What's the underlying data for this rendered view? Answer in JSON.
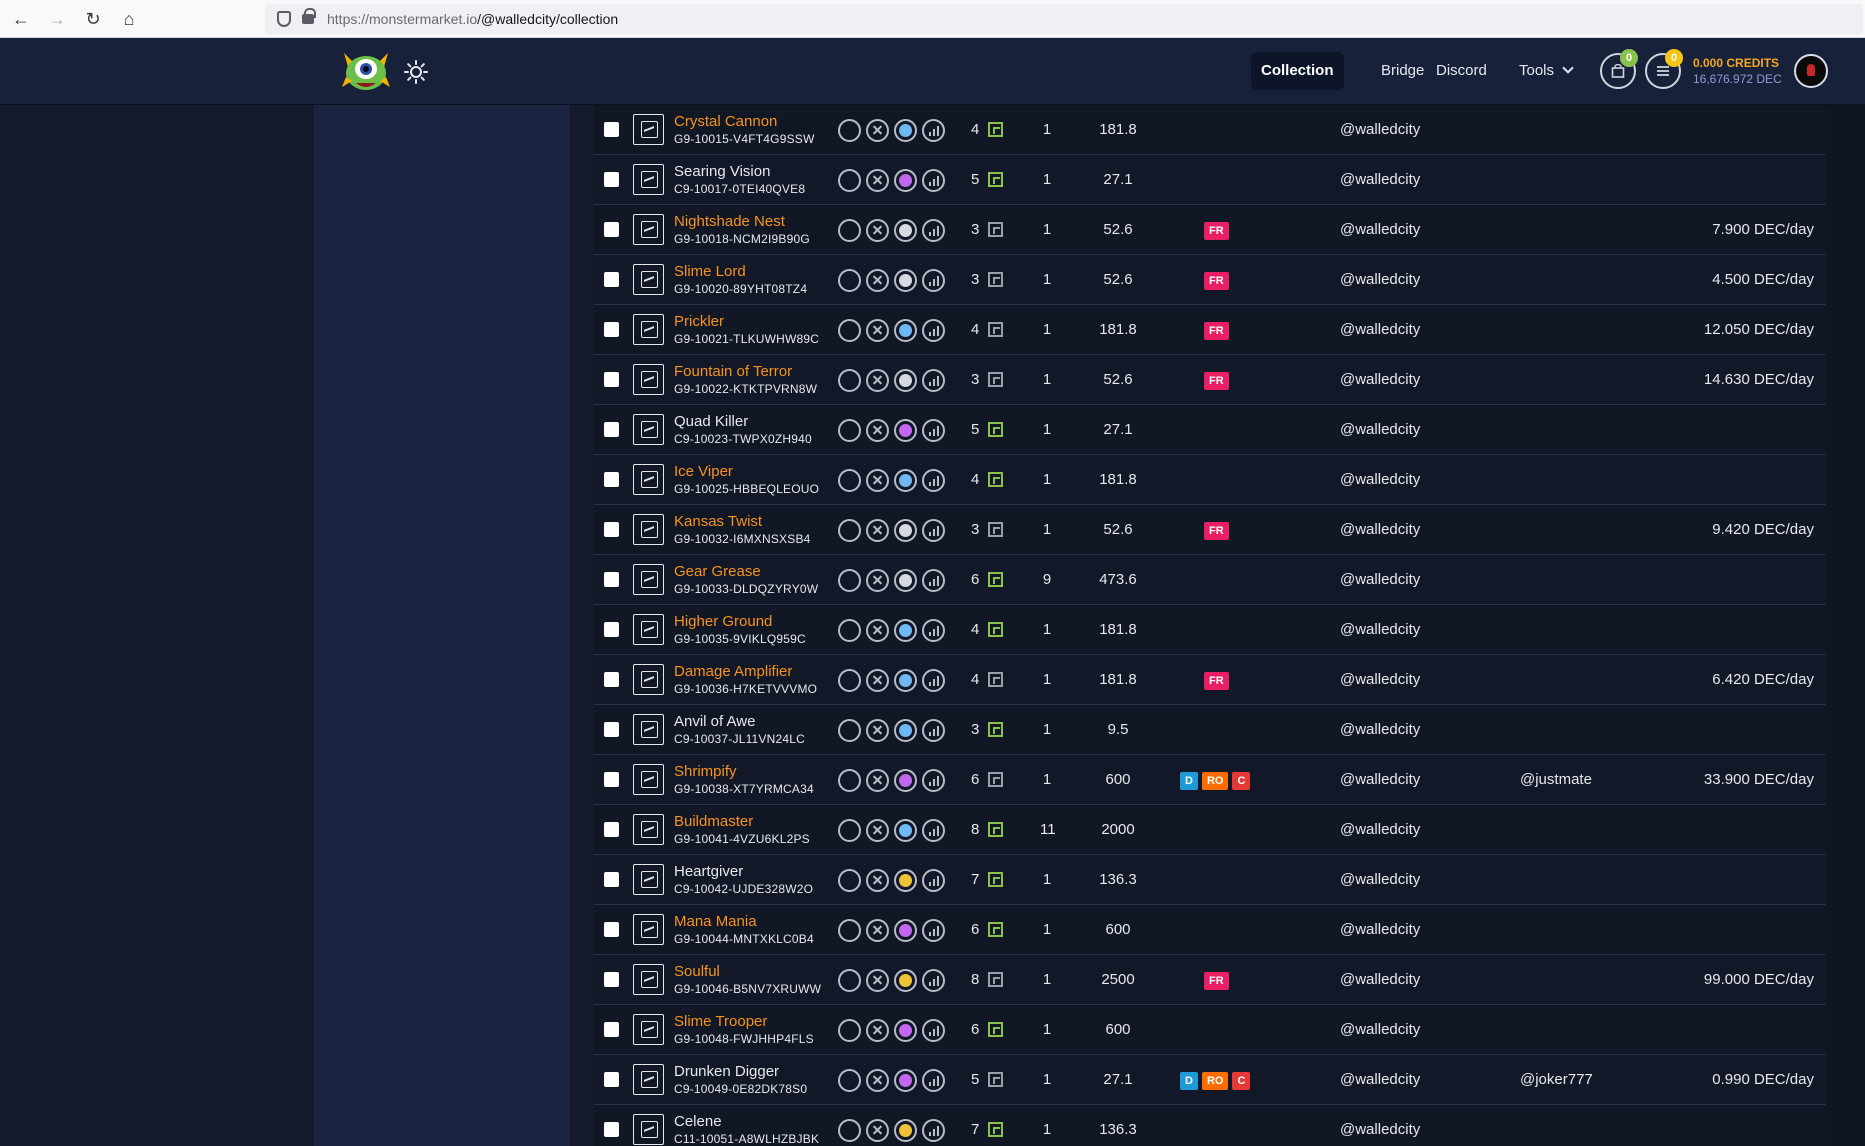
{
  "browser": {
    "url_host": "https://monstermarket.io",
    "url_path": "/@walledcity/collection"
  },
  "header": {
    "nav": [
      {
        "label": "Collection",
        "active": true
      },
      {
        "label": "Bridge",
        "active": false
      },
      {
        "label": "Discord",
        "active": false
      },
      {
        "label": "Tools",
        "active": false
      }
    ],
    "cart_count": "0",
    "list_count": "0",
    "credits": "0.000 CREDITS",
    "dec": "16,676.972 DEC"
  },
  "colors": {
    "gold": "#f0c237",
    "blue": "#6eb8f4",
    "purple": "#c367f0",
    "silver": "#d6d9df",
    "orange": "#f7931e",
    "green_badge": "#8bc34a",
    "yellow_badge": "#f5c518"
  },
  "rows": [
    {
      "name": "Crystal Cannon",
      "code": "G9-10015-V4FT4G9SSW",
      "gold": true,
      "element": "blue",
      "level": "4",
      "card_green": true,
      "qty": "1",
      "power": "181.8",
      "tags": [],
      "owner": "@walledcity",
      "renter": "",
      "rate": ""
    },
    {
      "name": "Searing Vision",
      "code": "C9-10017-0TEI40QVE8",
      "gold": false,
      "element": "purple",
      "level": "5",
      "card_green": true,
      "qty": "1",
      "power": "27.1",
      "tags": [],
      "owner": "@walledcity",
      "renter": "",
      "rate": ""
    },
    {
      "name": "Nightshade Nest",
      "code": "G9-10018-NCM2I9B90G",
      "gold": true,
      "element": "silver",
      "level": "3",
      "card_green": false,
      "qty": "1",
      "power": "52.6",
      "tags": [
        "FR"
      ],
      "owner": "@walledcity",
      "renter": "",
      "rate": "7.900 DEC/day"
    },
    {
      "name": "Slime Lord",
      "code": "G9-10020-89YHT08TZ4",
      "gold": true,
      "element": "silver",
      "level": "3",
      "card_green": false,
      "qty": "1",
      "power": "52.6",
      "tags": [
        "FR"
      ],
      "owner": "@walledcity",
      "renter": "",
      "rate": "4.500 DEC/day"
    },
    {
      "name": "Prickler",
      "code": "G9-10021-TLKUWHW89C",
      "gold": true,
      "element": "blue",
      "level": "4",
      "card_green": false,
      "qty": "1",
      "power": "181.8",
      "tags": [
        "FR"
      ],
      "owner": "@walledcity",
      "renter": "",
      "rate": "12.050 DEC/day"
    },
    {
      "name": "Fountain of Terror",
      "code": "G9-10022-KTKTPVRN8W",
      "gold": true,
      "element": "silver",
      "level": "3",
      "card_green": false,
      "qty": "1",
      "power": "52.6",
      "tags": [
        "FR"
      ],
      "owner": "@walledcity",
      "renter": "",
      "rate": "14.630 DEC/day"
    },
    {
      "name": "Quad Killer",
      "code": "C9-10023-TWPX0ZH940",
      "gold": false,
      "element": "purple",
      "level": "5",
      "card_green": true,
      "qty": "1",
      "power": "27.1",
      "tags": [],
      "owner": "@walledcity",
      "renter": "",
      "rate": ""
    },
    {
      "name": "Ice Viper",
      "code": "G9-10025-HBBEQLEOUO",
      "gold": true,
      "element": "blue",
      "level": "4",
      "card_green": true,
      "qty": "1",
      "power": "181.8",
      "tags": [],
      "owner": "@walledcity",
      "renter": "",
      "rate": ""
    },
    {
      "name": "Kansas Twist",
      "code": "G9-10032-I6MXNSXSB4",
      "gold": true,
      "element": "silver",
      "level": "3",
      "card_green": false,
      "qty": "1",
      "power": "52.6",
      "tags": [
        "FR"
      ],
      "owner": "@walledcity",
      "renter": "",
      "rate": "9.420 DEC/day"
    },
    {
      "name": "Gear Grease",
      "code": "G9-10033-DLDQZYRY0W",
      "gold": true,
      "element": "silver",
      "level": "6",
      "card_green": true,
      "qty": "9",
      "power": "473.6",
      "tags": [],
      "owner": "@walledcity",
      "renter": "",
      "rate": ""
    },
    {
      "name": "Higher Ground",
      "code": "G9-10035-9VIKLQ959C",
      "gold": true,
      "element": "blue",
      "level": "4",
      "card_green": true,
      "qty": "1",
      "power": "181.8",
      "tags": [],
      "owner": "@walledcity",
      "renter": "",
      "rate": ""
    },
    {
      "name": "Damage Amplifier",
      "code": "G9-10036-H7KETVVVMO",
      "gold": true,
      "element": "blue",
      "level": "4",
      "card_green": false,
      "qty": "1",
      "power": "181.8",
      "tags": [
        "FR"
      ],
      "owner": "@walledcity",
      "renter": "",
      "rate": "6.420 DEC/day"
    },
    {
      "name": "Anvil of Awe",
      "code": "C9-10037-JL11VN24LC",
      "gold": false,
      "element": "blue",
      "level": "3",
      "card_green": true,
      "qty": "1",
      "power": "9.5",
      "tags": [],
      "owner": "@walledcity",
      "renter": "",
      "rate": ""
    },
    {
      "name": "Shrimpify",
      "code": "G9-10038-XT7YRMCA34",
      "gold": true,
      "element": "purple",
      "level": "6",
      "card_green": false,
      "qty": "1",
      "power": "600",
      "tags": [
        "D",
        "RO",
        "C"
      ],
      "owner": "@walledcity",
      "renter": "@justmate",
      "rate": "33.900 DEC/day"
    },
    {
      "name": "Buildmaster",
      "code": "G9-10041-4VZU6KL2PS",
      "gold": true,
      "element": "blue",
      "level": "8",
      "card_green": true,
      "qty": "11",
      "power": "2000",
      "tags": [],
      "owner": "@walledcity",
      "renter": "",
      "rate": ""
    },
    {
      "name": "Heartgiver",
      "code": "C9-10042-UJDE328W2O",
      "gold": false,
      "element": "gold",
      "level": "7",
      "card_green": true,
      "qty": "1",
      "power": "136.3",
      "tags": [],
      "owner": "@walledcity",
      "renter": "",
      "rate": ""
    },
    {
      "name": "Mana Mania",
      "code": "G9-10044-MNTXKLC0B4",
      "gold": true,
      "element": "purple",
      "level": "6",
      "card_green": true,
      "qty": "1",
      "power": "600",
      "tags": [],
      "owner": "@walledcity",
      "renter": "",
      "rate": ""
    },
    {
      "name": "Soulful",
      "code": "G9-10046-B5NV7XRUWW",
      "gold": true,
      "element": "gold",
      "level": "8",
      "card_green": false,
      "qty": "1",
      "power": "2500",
      "tags": [
        "FR"
      ],
      "owner": "@walledcity",
      "renter": "",
      "rate": "99.000 DEC/day"
    },
    {
      "name": "Slime Trooper",
      "code": "G9-10048-FWJHHP4FLS",
      "gold": true,
      "element": "purple",
      "level": "6",
      "card_green": true,
      "qty": "1",
      "power": "600",
      "tags": [],
      "owner": "@walledcity",
      "renter": "",
      "rate": ""
    },
    {
      "name": "Drunken Digger",
      "code": "C9-10049-0E82DK78S0",
      "gold": false,
      "element": "purple",
      "level": "5",
      "card_green": false,
      "qty": "1",
      "power": "27.1",
      "tags": [
        "D",
        "RO",
        "C"
      ],
      "owner": "@walledcity",
      "renter": "@joker777",
      "rate": "0.990 DEC/day"
    },
    {
      "name": "Celene",
      "code": "C11-10051-A8WLHZBJBK",
      "gold": false,
      "element": "gold",
      "level": "7",
      "card_green": true,
      "qty": "1",
      "power": "136.3",
      "tags": [],
      "owner": "@walledcity",
      "renter": "",
      "rate": ""
    }
  ]
}
